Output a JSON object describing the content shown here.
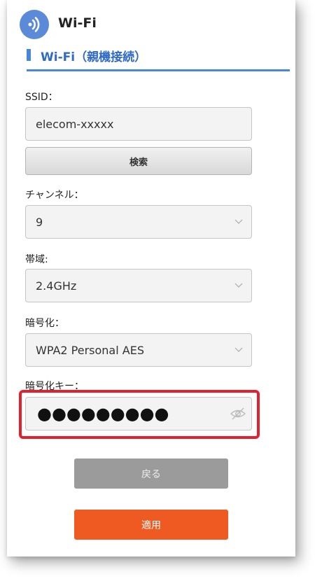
{
  "header": {
    "title": "Wi-Fi",
    "icon": "wifi-signal-icon",
    "icon_color": "#5b8bd8"
  },
  "section": {
    "title": "Wi-Fi（親機接続）",
    "accent": "#4a86d8"
  },
  "ssid": {
    "label": "SSID：",
    "value": "elecom-xxxxx"
  },
  "search_button": "検索",
  "channel": {
    "label": "チャンネル：",
    "value": "9"
  },
  "band": {
    "label": "帯域:",
    "value": "2.4GHz"
  },
  "encryption": {
    "label": "暗号化：",
    "value": "WPA2 Personal AES"
  },
  "key": {
    "label": "暗号化キー：",
    "value": "●●●●●●●●●",
    "toggle_icon": "eye-slash-icon",
    "highlight_color": "#e4202f"
  },
  "buttons": {
    "back": "戻る",
    "apply": "適用",
    "apply_color": "#ef5a22"
  }
}
